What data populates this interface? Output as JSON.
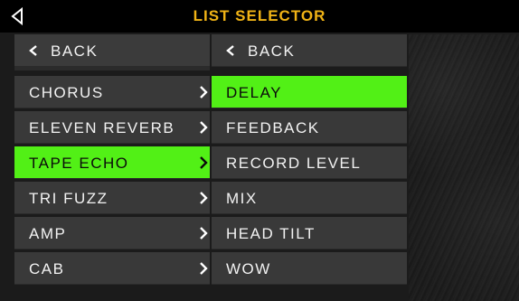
{
  "header": {
    "title": "LIST SELECTOR",
    "back_icon": "triangle-left-icon",
    "title_color": "#f0b316"
  },
  "left_list": {
    "back_label": "BACK",
    "items": [
      {
        "label": "CHORUS",
        "selected": false
      },
      {
        "label": "ELEVEN REVERB",
        "selected": false
      },
      {
        "label": "TAPE ECHO",
        "selected": true
      },
      {
        "label": "TRI FUZZ",
        "selected": false
      },
      {
        "label": "AMP",
        "selected": false
      },
      {
        "label": "CAB",
        "selected": false
      }
    ]
  },
  "right_list": {
    "back_label": "BACK",
    "items": [
      {
        "label": "DELAY",
        "selected": true
      },
      {
        "label": "FEEDBACK",
        "selected": false
      },
      {
        "label": "RECORD LEVEL",
        "selected": false
      },
      {
        "label": "MIX",
        "selected": false
      },
      {
        "label": "HEAD TILT",
        "selected": false
      },
      {
        "label": "WOW",
        "selected": false
      }
    ]
  },
  "colors": {
    "selected_bg": "#52f016",
    "row_bg": "#393939",
    "header_bg": "#000000"
  }
}
